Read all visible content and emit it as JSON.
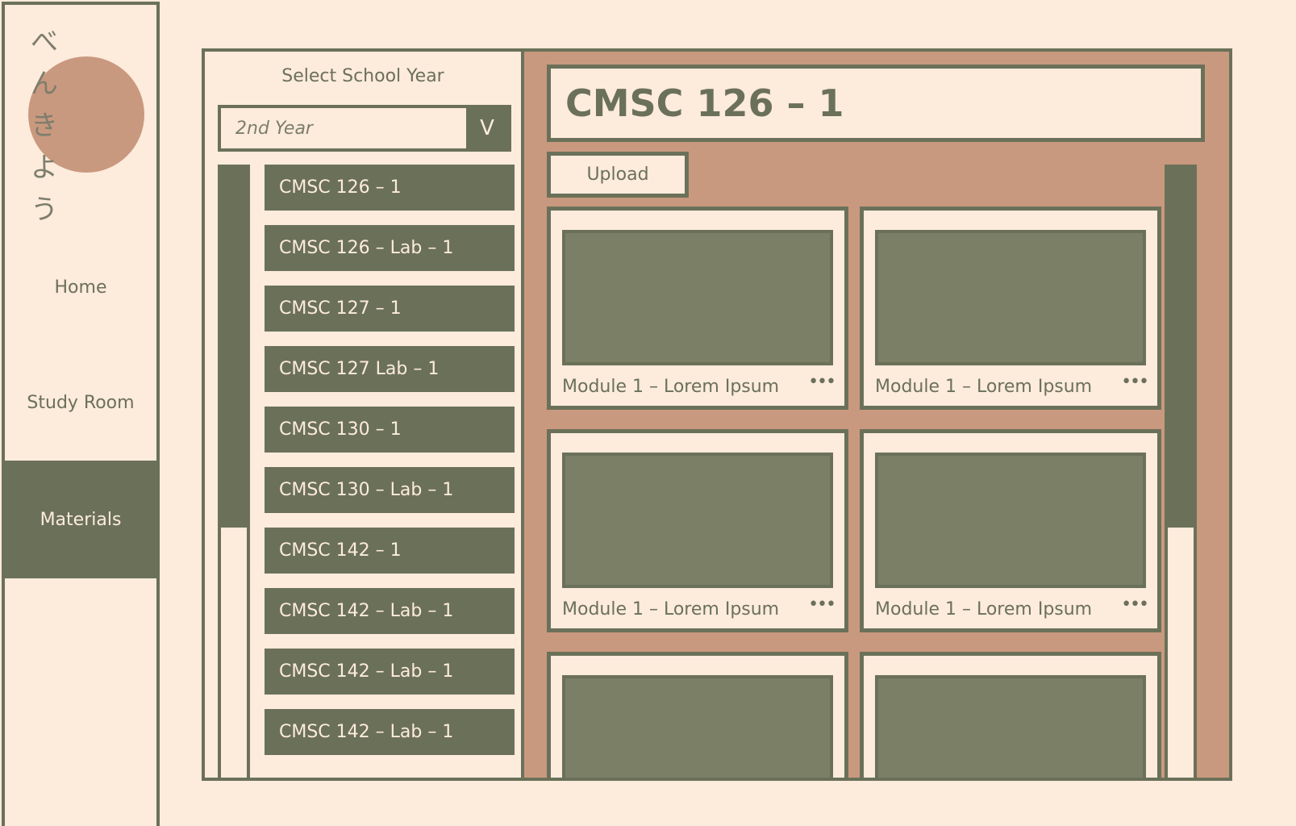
{
  "brand": {
    "logo_chars": [
      "べ",
      "ん",
      "き",
      "よ",
      "う"
    ]
  },
  "nav": {
    "home": "Home",
    "study_room": "Study Room",
    "materials": "Materials"
  },
  "course_selector": {
    "label": "Select School Year",
    "selected_year": "2nd Year",
    "chevron": "V",
    "courses": [
      "CMSC 126 – 1",
      "CMSC 126 – Lab – 1",
      "CMSC 127 – 1",
      "CMSC 127 Lab – 1",
      "CMSC 130 – 1",
      "CMSC 130 – Lab – 1",
      "CMSC 142 – 1",
      "CMSC 142 – Lab – 1",
      "CMSC 142 – Lab – 1",
      "CMSC 142 – Lab – 1"
    ]
  },
  "materials": {
    "title": "CMSC 126 – 1",
    "upload_label": "Upload",
    "more_icon": "•••",
    "cards": [
      {
        "label": "Module 1 – Lorem Ipsum"
      },
      {
        "label": "Module 1 – Lorem Ipsum"
      },
      {
        "label": "Module 1 – Lorem Ipsum"
      },
      {
        "label": "Module 1 – Lorem Ipsum"
      },
      {
        "label": ""
      },
      {
        "label": ""
      }
    ]
  },
  "colors": {
    "background": "#fdebdc",
    "primary_green": "#6b7159",
    "accent_terracotta": "#c9997f",
    "thumb_green": "#7a7f66"
  }
}
